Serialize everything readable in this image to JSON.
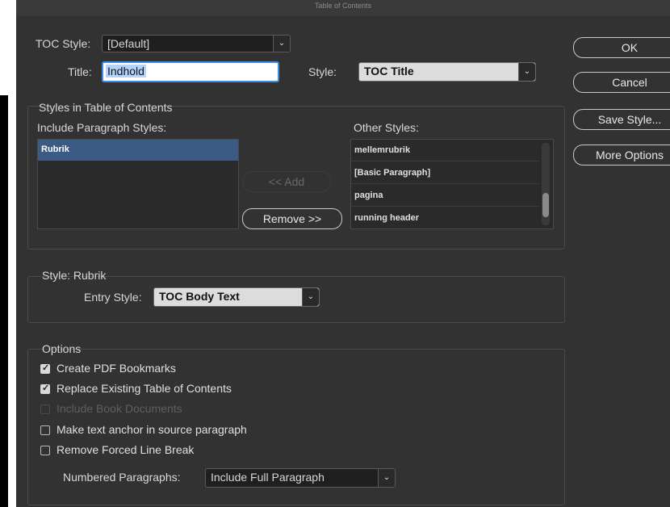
{
  "window": {
    "title": "Table of Contents"
  },
  "toc_style": {
    "label": "TOC Style:",
    "value": "[Default]"
  },
  "title": {
    "label": "Title:",
    "value": "Indhold"
  },
  "title_style": {
    "label": "Style:",
    "value": "TOC Title"
  },
  "buttons": {
    "ok": "OK",
    "cancel": "Cancel",
    "save_style": "Save Style...",
    "more_options": "More Options",
    "add": "<< Add",
    "remove": "Remove >>"
  },
  "styles_section": {
    "heading": "Styles in Table of Contents",
    "include_label": "Include Paragraph Styles:",
    "include_items": [
      "Rubrik"
    ],
    "other_label": "Other Styles:",
    "other_items": [
      "mellemrubrik",
      "[Basic Paragraph]",
      "pagina",
      "running header"
    ]
  },
  "style_section": {
    "heading": "Style: Rubrik",
    "entry_label": "Entry Style:",
    "entry_value": "TOC Body Text"
  },
  "options": {
    "heading": "Options",
    "items": [
      {
        "label": "Create PDF Bookmarks",
        "checked": true,
        "enabled": true
      },
      {
        "label": "Replace Existing Table of Contents",
        "checked": true,
        "enabled": true
      },
      {
        "label": "Include Book Documents",
        "checked": false,
        "enabled": false
      },
      {
        "label": "Make text anchor in source paragraph",
        "checked": false,
        "enabled": true
      },
      {
        "label": "Remove Forced Line Break",
        "checked": false,
        "enabled": true
      }
    ],
    "numbered_label": "Numbered Paragraphs:",
    "numbered_value": "Include Full Paragraph"
  }
}
